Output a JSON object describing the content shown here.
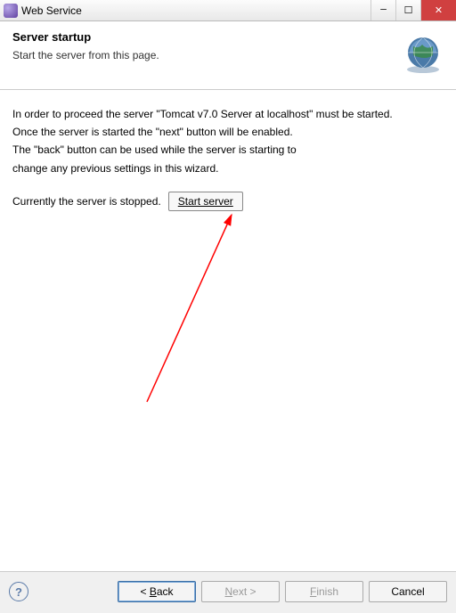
{
  "title": "Web Service",
  "header": {
    "heading": "Server startup",
    "subheading": "Start the server from this page."
  },
  "body": {
    "line1": "In order to proceed the server \"Tomcat v7.0 Server at localhost\" must be started.",
    "line2": "Once the server is started the \"next\" button will be enabled.",
    "line3": "The \"back\" button can be used while the server is starting to",
    "line4": "change any previous settings in this wizard.",
    "status": "Currently the server is stopped.",
    "start_label": "Start server"
  },
  "footer": {
    "help_glyph": "?",
    "back_prefix": "< ",
    "back_m": "B",
    "back_rest": "ack",
    "next_m": "N",
    "next_rest": "ext >",
    "finish_pre": "",
    "finish_m": "F",
    "finish_rest": "inish",
    "cancel_label": "Cancel"
  }
}
